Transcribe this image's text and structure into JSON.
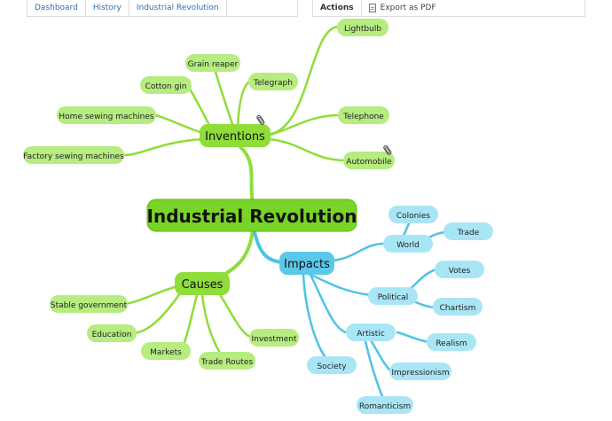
{
  "breadcrumbs": {
    "items": [
      "Dashboard",
      "History",
      "Industrial Revolution"
    ]
  },
  "actions": {
    "title": "Actions",
    "export_label": "Export as PDF"
  },
  "map": {
    "root": "Industrial Revolution",
    "inventions": {
      "label": "Inventions",
      "children": [
        "Lightbulb",
        "Grain reaper",
        "Telegraph",
        "Cotton gin",
        "Home sewing machines",
        "Telephone",
        "Factory sewing machines",
        "Automobile"
      ]
    },
    "impacts": {
      "label": "Impacts",
      "world": {
        "label": "World",
        "children": [
          "Colonies",
          "Trade"
        ]
      },
      "political": {
        "label": "Political",
        "children": [
          "Votes",
          "Chartism"
        ]
      },
      "artistic": {
        "label": "Artistic",
        "children": [
          "Realism",
          "Impressionism",
          "Romanticism"
        ]
      },
      "society": "Society"
    },
    "causes": {
      "label": "Causes",
      "children": [
        "Stable government",
        "Education",
        "Markets",
        "Trade Routes",
        "Investment"
      ]
    }
  },
  "colors": {
    "green_branch": "#8fdd3a",
    "green_node": "#b6ec80",
    "green_main": "#78d427",
    "blue_branch": "#4fc3e3",
    "blue_node": "#a9e6f5",
    "blue_main": "#5bc8ea"
  }
}
